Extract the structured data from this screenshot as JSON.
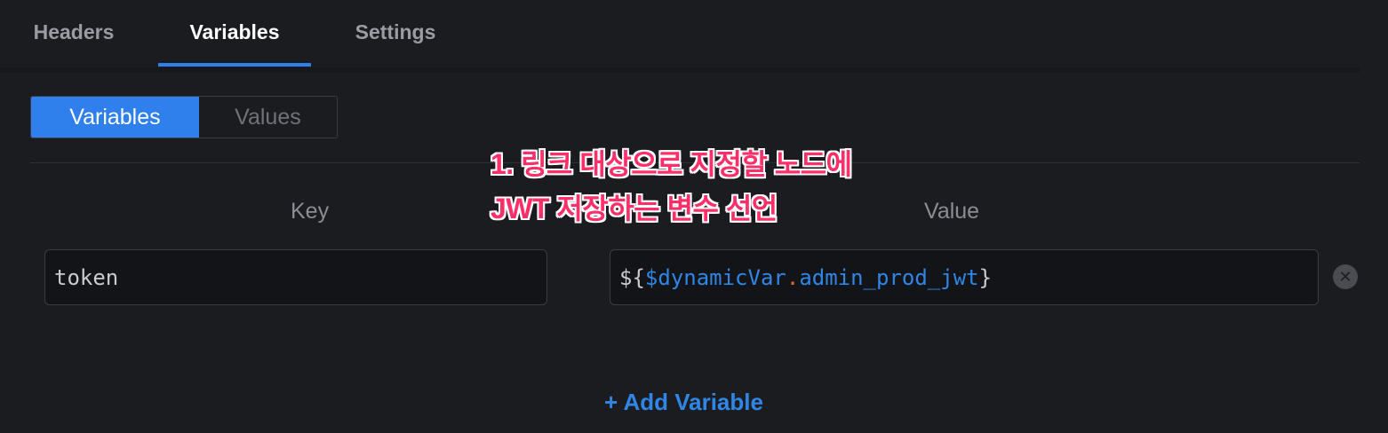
{
  "tabs": [
    {
      "label": "Headers",
      "active": false
    },
    {
      "label": "Variables",
      "active": true
    },
    {
      "label": "Settings",
      "active": false
    }
  ],
  "segmented": {
    "variables_label": "Variables",
    "values_label": "Values",
    "active": "Variables"
  },
  "columns": {
    "key": "Key",
    "value": "Value"
  },
  "rows": [
    {
      "key": "token",
      "value": {
        "prefix": "${",
        "var": "$dynamicVar",
        "dot": ".",
        "prop": "admin_prod_jwt",
        "suffix": "}"
      }
    }
  ],
  "add_variable_label": "+ Add Variable",
  "annotation": {
    "line1": "1. 링크 대상으로 지정할 노드에",
    "line2": "JWT 저장하는 변수 선언"
  },
  "icons": {
    "remove": "close-circle-icon"
  },
  "colors": {
    "accent": "#2f80ed",
    "annotation": "#ff2f6a",
    "variable_token": "#2f86e6",
    "dot_token": "#e36a2f"
  }
}
